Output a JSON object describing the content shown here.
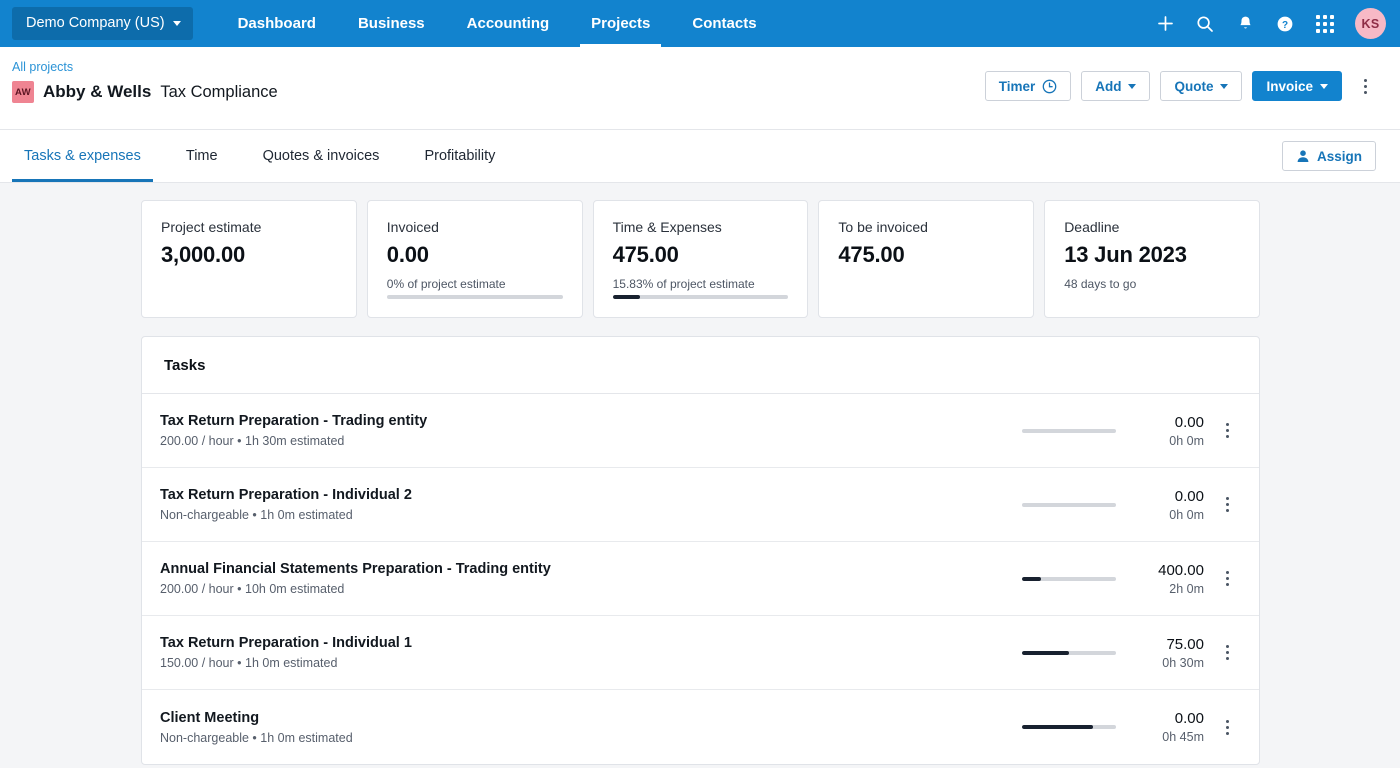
{
  "topnav": {
    "org": "Demo Company (US)",
    "links": [
      {
        "label": "Dashboard",
        "active": false
      },
      {
        "label": "Business",
        "active": false
      },
      {
        "label": "Accounting",
        "active": false
      },
      {
        "label": "Projects",
        "active": true
      },
      {
        "label": "Contacts",
        "active": false
      }
    ],
    "icons": [
      "plus-icon",
      "search-icon",
      "bell-icon",
      "help-icon",
      "apps-grid-icon"
    ],
    "avatar_initials": "KS",
    "bar_color": "#1283ce",
    "avatar_color": "#f7b9c6"
  },
  "project_header": {
    "breadcrumb": "All projects",
    "client_initials": "AW",
    "client_name": "Abby & Wells",
    "project_name": "Tax Compliance",
    "actions": {
      "timer": "Timer",
      "add": "Add",
      "quote": "Quote",
      "invoice": "Invoice"
    }
  },
  "tabs": [
    {
      "label": "Tasks & expenses",
      "active": true
    },
    {
      "label": "Time",
      "active": false
    },
    {
      "label": "Quotes & invoices",
      "active": false
    },
    {
      "label": "Profitability",
      "active": false
    }
  ],
  "assign_button": "Assign",
  "summary_cards": [
    {
      "label": "Project estimate",
      "value": "3,000.00",
      "sub": "",
      "progress": null
    },
    {
      "label": "Invoiced",
      "value": "0.00",
      "sub": "0% of project estimate",
      "progress": 0
    },
    {
      "label": "Time & Expenses",
      "value": "475.00",
      "sub": "15.83% of project estimate",
      "progress": 15.83
    },
    {
      "label": "To be invoiced",
      "value": "475.00",
      "sub": "",
      "progress": null
    },
    {
      "label": "Deadline",
      "value": "13 Jun 2023",
      "sub": "48 days to go",
      "progress": null
    }
  ],
  "tasks_panel": {
    "heading": "Tasks",
    "rows": [
      {
        "title": "Tax Return Preparation - Trading entity",
        "meta": "200.00 / hour • 1h 30m estimated",
        "amount": "0.00",
        "time": "0h 0m",
        "progress": 0
      },
      {
        "title": "Tax Return Preparation - Individual 2",
        "meta": "Non-chargeable • 1h 0m estimated",
        "amount": "0.00",
        "time": "0h 0m",
        "progress": 0
      },
      {
        "title": "Annual Financial Statements Preparation - Trading entity",
        "meta": "200.00 / hour • 10h 0m estimated",
        "amount": "400.00",
        "time": "2h 0m",
        "progress": 20
      },
      {
        "title": "Tax Return Preparation - Individual 1",
        "meta": "150.00 / hour • 1h 0m estimated",
        "amount": "75.00",
        "time": "0h 30m",
        "progress": 50
      },
      {
        "title": "Client Meeting",
        "meta": "Non-chargeable • 1h 0m estimated",
        "amount": "0.00",
        "time": "0h 45m",
        "progress": 75
      }
    ]
  }
}
